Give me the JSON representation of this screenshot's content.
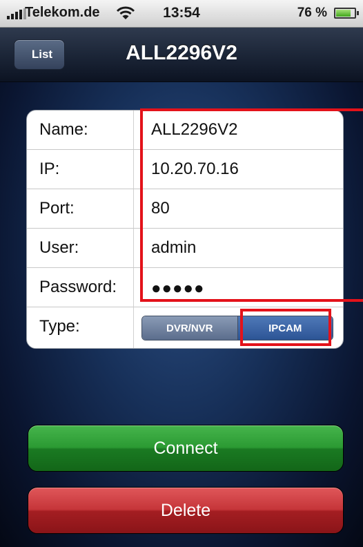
{
  "status_bar": {
    "carrier": "Telekom.de",
    "time": "13:54",
    "battery_percent": "76 %",
    "battery_level": 0.76
  },
  "nav": {
    "back_label": "List",
    "title": "ALL2296V2"
  },
  "form": {
    "rows": [
      {
        "label": "Name:",
        "value": "ALL2296V2"
      },
      {
        "label": "IP:",
        "value": "10.20.70.16"
      },
      {
        "label": "Port:",
        "value": "80"
      },
      {
        "label": "User:",
        "value": "admin"
      },
      {
        "label": "Password:",
        "value": "●●●●●"
      }
    ],
    "type": {
      "label": "Type:",
      "options": [
        "DVR/NVR",
        "IPCAM"
      ],
      "selected": "IPCAM"
    }
  },
  "buttons": {
    "connect": "Connect",
    "delete": "Delete"
  },
  "colors": {
    "highlight": "#e3121a",
    "connect": "#2b9a33",
    "delete": "#c53539"
  }
}
